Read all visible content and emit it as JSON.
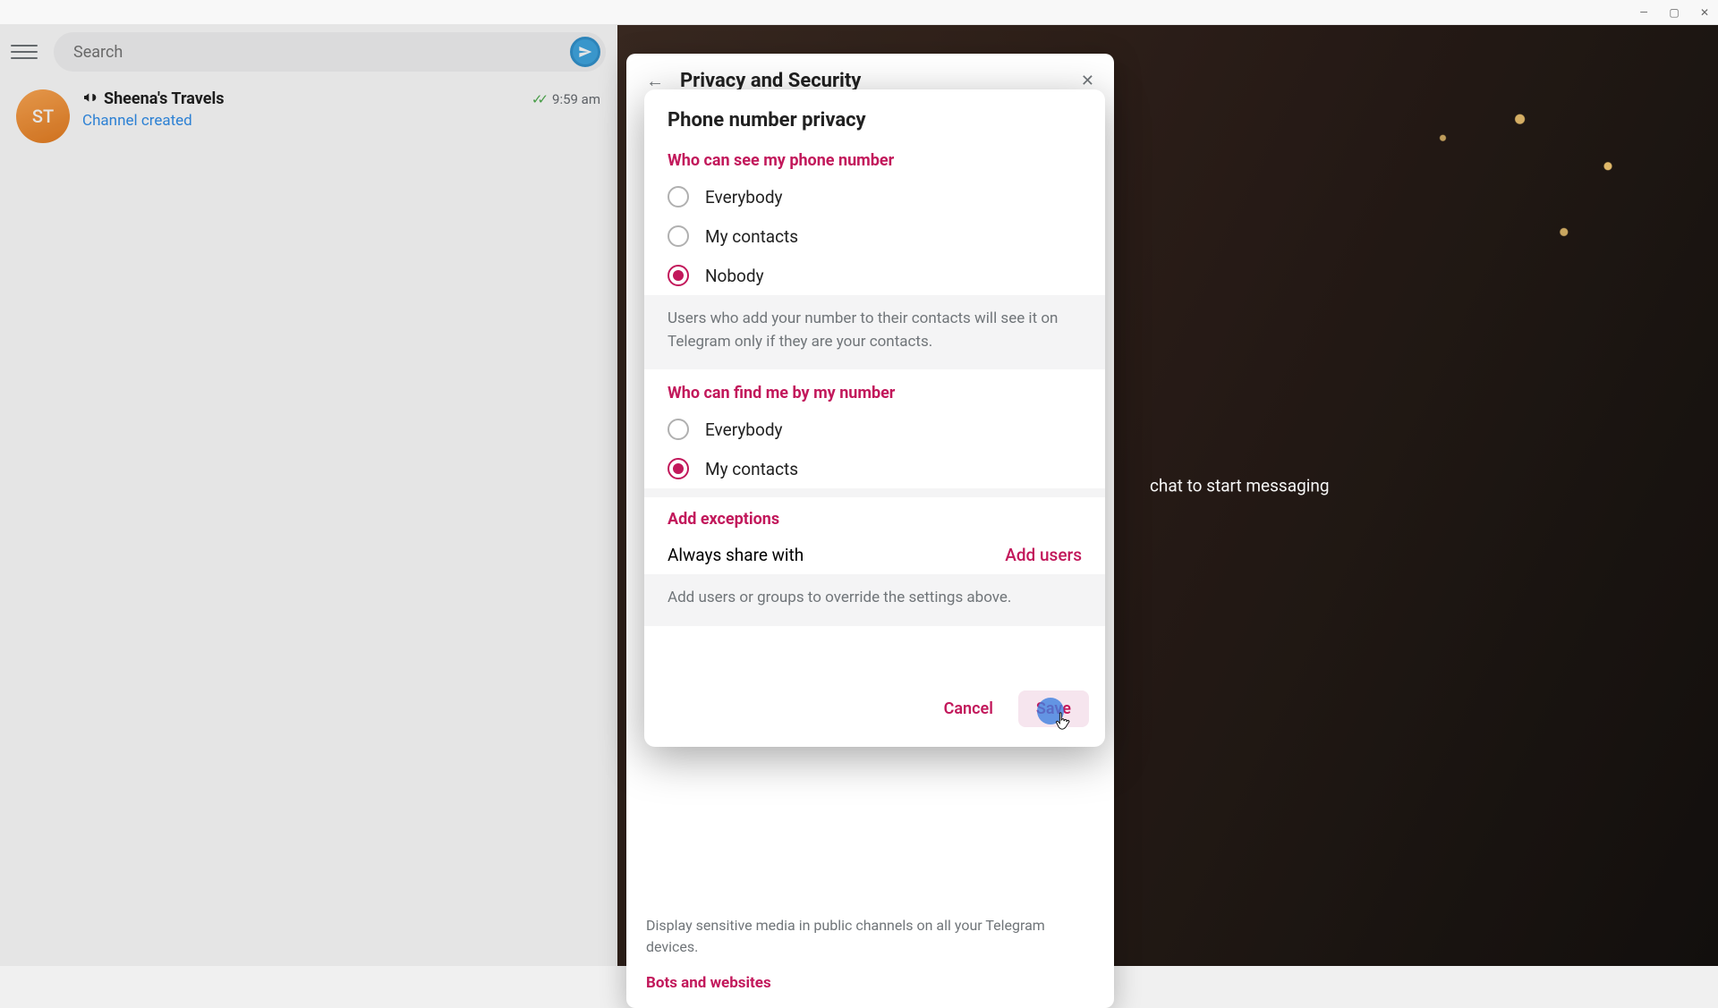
{
  "window": {
    "min": "min",
    "max": "max",
    "close": "close"
  },
  "search": {
    "placeholder": "Search"
  },
  "chat": {
    "avatar_initials": "ST",
    "name": "Sheena's Travels",
    "time": "9:59 am",
    "subtitle": "Channel created"
  },
  "background_hint": "chat to start messaging",
  "parent_panel": {
    "title": "Privacy and Security",
    "footer": "Display sensitive media in public channels on all your Telegram devices.",
    "next_section": "Bots and websites"
  },
  "modal": {
    "title": "Phone number privacy",
    "see_section": "Who can see my phone number",
    "see_options": {
      "everybody": "Everybody",
      "my_contacts": "My contacts",
      "nobody": "Nobody"
    },
    "see_selected": "nobody",
    "see_info": "Users who add your number to their contacts will see it on Telegram only if they are your contacts.",
    "find_section": "Who can find me by my number",
    "find_options": {
      "everybody": "Everybody",
      "my_contacts": "My contacts"
    },
    "find_selected": "my_contacts",
    "exceptions_title": "Add exceptions",
    "always_share": "Always share with",
    "add_users": "Add users",
    "exceptions_info": "Add users or groups to override the settings above.",
    "cancel": "Cancel",
    "save": "Save"
  }
}
